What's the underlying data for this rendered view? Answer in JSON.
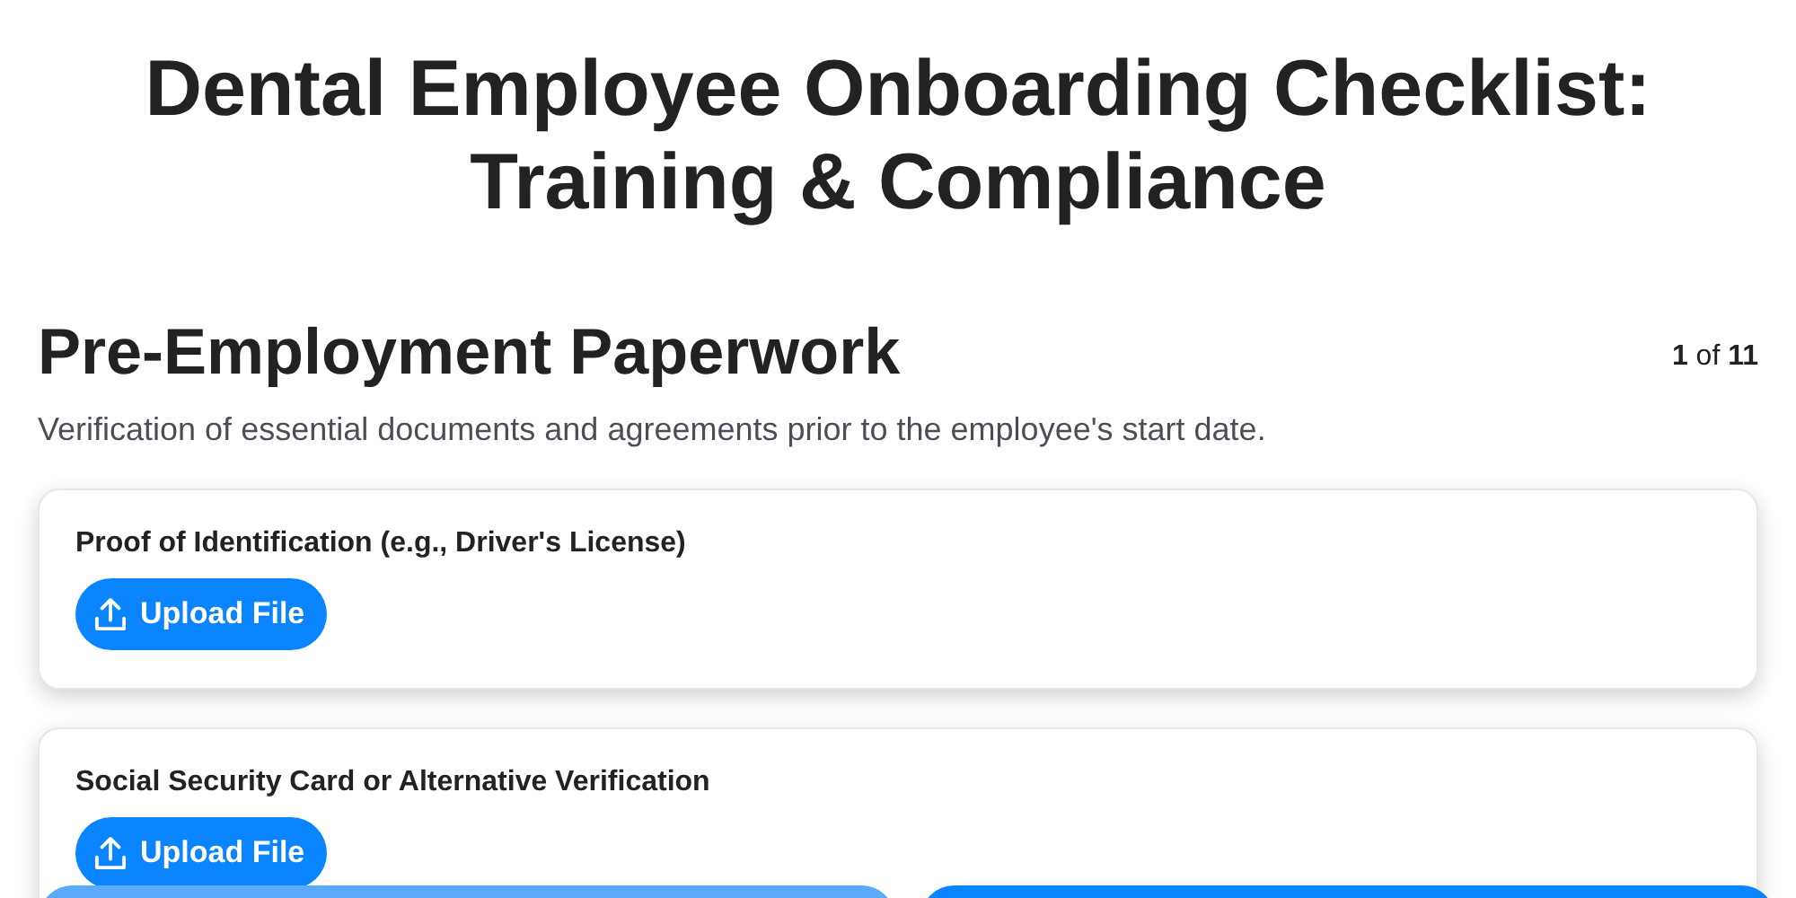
{
  "title": "Dental Employee Onboarding Checklist: Training & Compliance",
  "section": {
    "heading": "Pre-Employment Paperwork",
    "pager": "**1** of **11**",
    "description": "Verification of essential documents and agreements prior to the employee's start date."
  },
  "items": [
    {
      "label": "Proof of Identification (e.g., Driver's License)",
      "button": "Upload File"
    },
    {
      "label": "Social Security Card or Alternative Verification",
      "button": "Upload File"
    }
  ],
  "nav_buttons": [
    {
      "disabled": true
    },
    {
      "disabled": false
    }
  ]
}
